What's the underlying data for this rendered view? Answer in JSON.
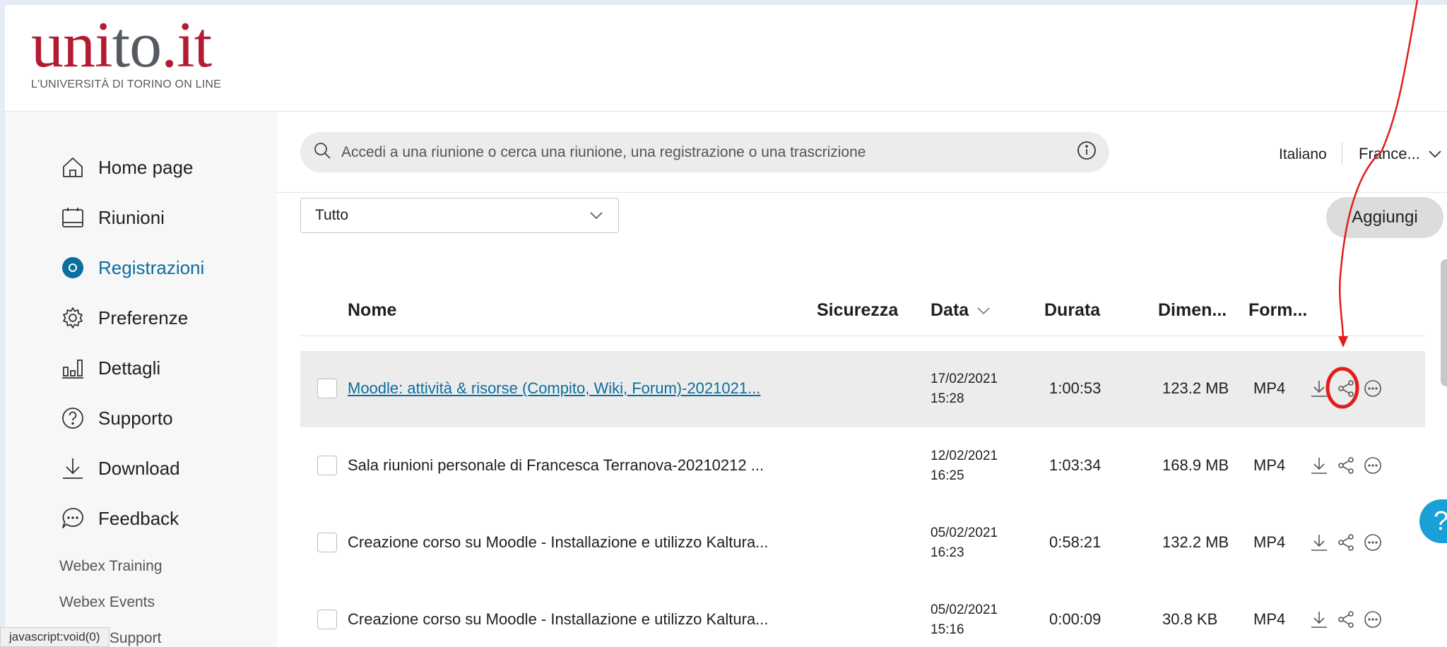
{
  "logo": {
    "main_a": "uni",
    "main_b": "to",
    "main_c": ".it",
    "subtitle": "L'UNIVERSITÀ DI TORINO ON LINE"
  },
  "sidebar": {
    "items": [
      {
        "label": "Home page",
        "icon": "home-icon"
      },
      {
        "label": "Riunioni",
        "icon": "calendar-icon"
      },
      {
        "label": "Registrazioni",
        "icon": "recording-icon",
        "active": true
      },
      {
        "label": "Preferenze",
        "icon": "gear-icon"
      },
      {
        "label": "Dettagli",
        "icon": "bar-chart-icon"
      },
      {
        "label": "Supporto",
        "icon": "help-icon"
      },
      {
        "label": "Download",
        "icon": "download-icon"
      },
      {
        "label": "Feedback",
        "icon": "chat-bubble-icon"
      }
    ],
    "links": [
      "Webex Training",
      "Webex Events",
      "Webex Support"
    ]
  },
  "status_bar": "javascript:void(0)",
  "search": {
    "placeholder": "Accedi a una riunione o cerca una riunione, una registrazione o una trascrizione"
  },
  "topbar": {
    "language": "Italiano",
    "user": "France..."
  },
  "filter": {
    "value": "Tutto"
  },
  "add_button": "Aggiungi",
  "table": {
    "headers": {
      "name": "Nome",
      "security": "Sicurezza",
      "date": "Data",
      "duration": "Durata",
      "size": "Dimen...",
      "format": "Form..."
    },
    "rows": [
      {
        "name": "Moodle: attività & risorse (Compito, Wiki, Forum)-2021021...",
        "date": "17/02/2021",
        "time": "15:28",
        "duration": "1:00:53",
        "size": "123.2 MB",
        "format": "MP4"
      },
      {
        "name": "Sala riunioni personale di Francesca Terranova-20210212 ...",
        "date": "12/02/2021",
        "time": "16:25",
        "duration": "1:03:34",
        "size": "168.9 MB",
        "format": "MP4"
      },
      {
        "name": "Creazione corso su Moodle - Installazione e utilizzo Kaltura...",
        "date": "05/02/2021",
        "time": "16:23",
        "duration": "0:58:21",
        "size": "132.2 MB",
        "format": "MP4"
      },
      {
        "name": "Creazione corso su Moodle - Installazione e utilizzo Kaltura...",
        "date": "05/02/2021",
        "time": "15:16",
        "duration": "0:00:09",
        "size": "30.8 KB",
        "format": "MP4"
      }
    ]
  },
  "help_bubble": "?",
  "colors": {
    "brand_red": "#b31b34",
    "accent_blue": "#0a6e9e",
    "annotation_red": "#e31b1b",
    "help_blue": "#1a9fd6"
  }
}
